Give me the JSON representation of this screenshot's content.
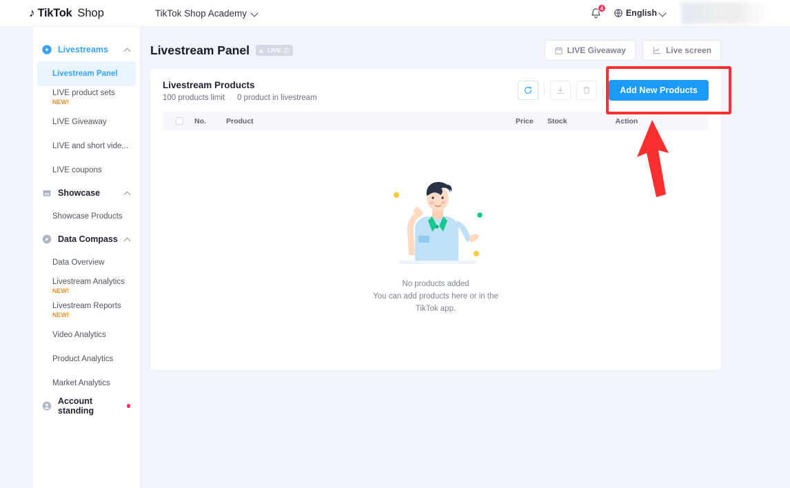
{
  "header": {
    "brand_tiktok": "TikTok",
    "brand_shop": "Shop",
    "account_switcher": "TikTok Shop Academy",
    "notification_count": "4",
    "language": "English",
    "redacted_label": ""
  },
  "sidebar": {
    "groups": [
      {
        "label": "Livestreams",
        "icon": "play-circle-icon",
        "expanded": true,
        "items": [
          {
            "label": "Livestream Panel",
            "active": true,
            "badge": ""
          },
          {
            "label": "LIVE product sets",
            "active": false,
            "badge": "NEW!"
          },
          {
            "label": "LIVE Giveaway",
            "active": false,
            "badge": ""
          },
          {
            "label": "LIVE and short vide...",
            "active": false,
            "badge": ""
          },
          {
            "label": "LIVE coupons",
            "active": false,
            "badge": ""
          }
        ]
      },
      {
        "label": "Showcase",
        "icon": "storefront-icon",
        "expanded": true,
        "items": [
          {
            "label": "Showcase Products",
            "active": false,
            "badge": ""
          }
        ]
      },
      {
        "label": "Data Compass",
        "icon": "compass-icon",
        "expanded": true,
        "items": [
          {
            "label": "Data Overview",
            "active": false,
            "badge": ""
          },
          {
            "label": "Livestream Analytics",
            "active": false,
            "badge": "NEW!"
          },
          {
            "label": "Livestream Reports",
            "active": false,
            "badge": "NEW!"
          },
          {
            "label": "Video Analytics",
            "active": false,
            "badge": ""
          },
          {
            "label": "Product Analytics",
            "active": false,
            "badge": ""
          },
          {
            "label": "Market Analytics",
            "active": false,
            "badge": ""
          }
        ]
      },
      {
        "label": "Account standing",
        "icon": "account-shield-icon",
        "expanded": false,
        "has_alert_dot": true,
        "items": []
      }
    ]
  },
  "page": {
    "title": "Livestream Panel",
    "live_badge_text": "LIVE",
    "buttons": {
      "live_giveaway": "LIVE Giveaway",
      "live_screen": "Live screen"
    }
  },
  "card": {
    "title": "Livestream Products",
    "subtitle_limit": "100 products limit",
    "subtitle_separator": "·",
    "subtitle_count": "0 product in livestream",
    "actions": {
      "refresh_icon": "refresh-icon",
      "export_icon": "download-icon",
      "delete_icon": "trash-icon",
      "add_products": "Add New Products"
    },
    "table": {
      "columns": [
        "No.",
        "Product",
        "Price",
        "Stock",
        "Action"
      ]
    },
    "empty_state": {
      "title": "No products added",
      "line2": "You can add products here or in the",
      "line3": "TikTok app.",
      "illustration": "confused-person-illustration"
    }
  },
  "annotations": {
    "highlight_target": "Add New Products",
    "arrow": "red-arrow-pointing-up"
  },
  "colors": {
    "accent_blue": "#1a9bf7",
    "page_bg": "#f1f4fb",
    "badge_red": "#fe2c55",
    "new_orange": "#fa8c16",
    "annotation_red": "#fb2f2f"
  }
}
